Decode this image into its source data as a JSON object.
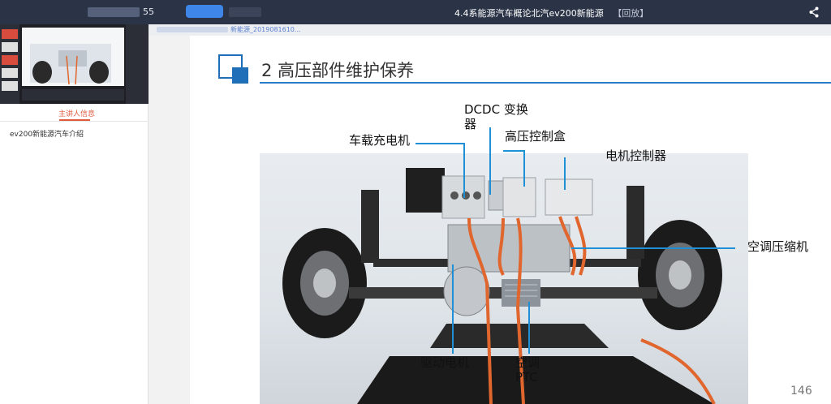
{
  "topbar": {
    "user_suffix": "55",
    "title": "4.4系能源汽车概论北汽ev200新能源",
    "replay_tag": "【回放】",
    "share_icon": "share-icon"
  },
  "left_panel": {
    "tab_label": "主讲人信息",
    "course_name": "ev200新能源汽车介绍"
  },
  "breadcrumb": {
    "text": "新能源_2019081610..."
  },
  "slide": {
    "title": "2  高压部件维护保养",
    "page_number": "146",
    "labels": {
      "dcdc": "DCDC 变换\n器",
      "charger": "车载充电机",
      "hv_box": "高压控制盒",
      "motor_ctrl": "电机控制器",
      "ac_compressor": "空调压缩机",
      "drive_motor": "驱动电机",
      "ac_ptc": "空调\nPTC"
    },
    "callout_color": "#1f8fd6",
    "cable_color": "#e0662e"
  }
}
